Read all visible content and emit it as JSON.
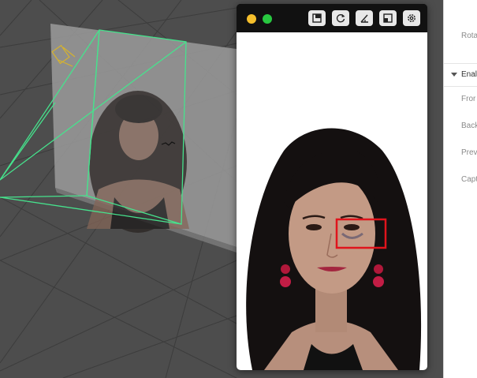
{
  "app": {
    "colors": {
      "viewport_bg": "#4d4d4d",
      "grid_line": "#3b3b3b",
      "frustum": "#46e38d",
      "tracking_box": "#e0141c",
      "close_button": "#f5bf2c",
      "zoom_button": "#28c840"
    }
  },
  "preview_window": {
    "toolbar": {
      "buttons": [
        {
          "icon": "frame-icon"
        },
        {
          "icon": "refresh-icon"
        },
        {
          "icon": "measure-icon"
        },
        {
          "icon": "window-icon"
        },
        {
          "icon": "gear-icon"
        }
      ]
    }
  },
  "inspector": {
    "rows": [
      {
        "label": "Rota"
      },
      {
        "label": "Enal"
      },
      {
        "label": "Fror"
      },
      {
        "label": "Back"
      },
      {
        "label": "Prev"
      },
      {
        "label": "Capt"
      }
    ]
  }
}
